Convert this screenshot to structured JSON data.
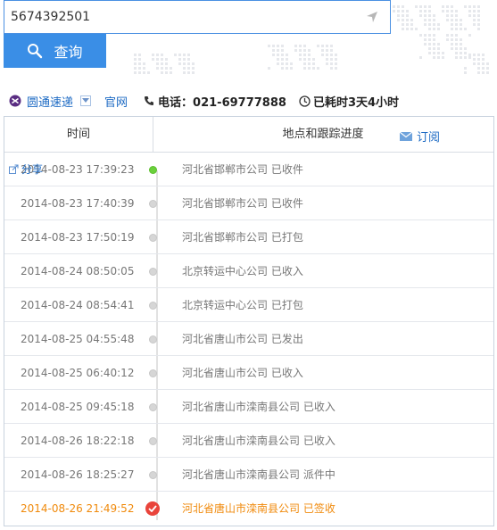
{
  "search": {
    "value": "5674392501"
  },
  "query_button": {
    "label": "查询"
  },
  "carrier": {
    "name": "圆通速递",
    "official_link": "官网",
    "phone": "电话：021-69777888",
    "elapsed": "已耗时3天4小时"
  },
  "table": {
    "header_time": "时间",
    "header_location": "地点和跟踪进度",
    "subscribe": "订阅",
    "share": "分享",
    "rows": [
      {
        "time": "2014-08-23 17:39:23",
        "location": "河北省邯郸市公司 已收件"
      },
      {
        "time": "2014-08-23 17:40:39",
        "location": "河北省邯郸市公司 已收件"
      },
      {
        "time": "2014-08-23 17:50:19",
        "location": "河北省邯郸市公司 已打包"
      },
      {
        "time": "2014-08-24 08:50:05",
        "location": "北京转运中心公司 已收入"
      },
      {
        "time": "2014-08-24 08:54:41",
        "location": "北京转运中心公司 已打包"
      },
      {
        "time": "2014-08-25 04:55:48",
        "location": "河北省唐山市公司 已发出"
      },
      {
        "time": "2014-08-25 06:40:12",
        "location": "河北省唐山市公司 已收入"
      },
      {
        "time": "2014-08-25 09:45:18",
        "location": "河北省唐山市滦南县公司 已收入"
      },
      {
        "time": "2014-08-26 18:22:18",
        "location": "河北省唐山市滦南县公司 已收入"
      },
      {
        "time": "2014-08-26 18:25:27",
        "location": "河北省唐山市滦南县公司 派件中"
      },
      {
        "time": "2014-08-26 21:49:52",
        "location": "河北省唐山市滦南县公司 已签收"
      }
    ]
  },
  "colors": {
    "accent": "#3a8ee6",
    "link": "#1e6bc4",
    "latest": "#f08a0c",
    "first_dot": "#6ad03b",
    "signed_badge": "#e9443b"
  }
}
